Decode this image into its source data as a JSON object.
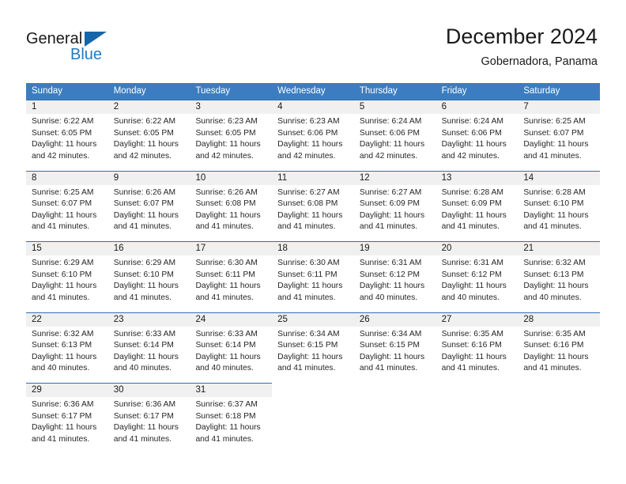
{
  "brand": {
    "name_part1": "General",
    "name_part2": "Blue"
  },
  "header": {
    "title": "December 2024",
    "subtitle": "Gobernadora, Panama"
  },
  "colors": {
    "header_blue": "#3b7dc0",
    "rule_blue": "#2f6fb5",
    "daynum_band": "#f0f0f0",
    "logo_blue": "#1f7bc4"
  },
  "weekday_headers": [
    "Sunday",
    "Monday",
    "Tuesday",
    "Wednesday",
    "Thursday",
    "Friday",
    "Saturday"
  ],
  "weeks": [
    [
      {
        "day": "1",
        "sunrise": "Sunrise: 6:22 AM",
        "sunset": "Sunset: 6:05 PM",
        "daylight1": "Daylight: 11 hours",
        "daylight2": "and 42 minutes."
      },
      {
        "day": "2",
        "sunrise": "Sunrise: 6:22 AM",
        "sunset": "Sunset: 6:05 PM",
        "daylight1": "Daylight: 11 hours",
        "daylight2": "and 42 minutes."
      },
      {
        "day": "3",
        "sunrise": "Sunrise: 6:23 AM",
        "sunset": "Sunset: 6:05 PM",
        "daylight1": "Daylight: 11 hours",
        "daylight2": "and 42 minutes."
      },
      {
        "day": "4",
        "sunrise": "Sunrise: 6:23 AM",
        "sunset": "Sunset: 6:06 PM",
        "daylight1": "Daylight: 11 hours",
        "daylight2": "and 42 minutes."
      },
      {
        "day": "5",
        "sunrise": "Sunrise: 6:24 AM",
        "sunset": "Sunset: 6:06 PM",
        "daylight1": "Daylight: 11 hours",
        "daylight2": "and 42 minutes."
      },
      {
        "day": "6",
        "sunrise": "Sunrise: 6:24 AM",
        "sunset": "Sunset: 6:06 PM",
        "daylight1": "Daylight: 11 hours",
        "daylight2": "and 42 minutes."
      },
      {
        "day": "7",
        "sunrise": "Sunrise: 6:25 AM",
        "sunset": "Sunset: 6:07 PM",
        "daylight1": "Daylight: 11 hours",
        "daylight2": "and 41 minutes."
      }
    ],
    [
      {
        "day": "8",
        "sunrise": "Sunrise: 6:25 AM",
        "sunset": "Sunset: 6:07 PM",
        "daylight1": "Daylight: 11 hours",
        "daylight2": "and 41 minutes."
      },
      {
        "day": "9",
        "sunrise": "Sunrise: 6:26 AM",
        "sunset": "Sunset: 6:07 PM",
        "daylight1": "Daylight: 11 hours",
        "daylight2": "and 41 minutes."
      },
      {
        "day": "10",
        "sunrise": "Sunrise: 6:26 AM",
        "sunset": "Sunset: 6:08 PM",
        "daylight1": "Daylight: 11 hours",
        "daylight2": "and 41 minutes."
      },
      {
        "day": "11",
        "sunrise": "Sunrise: 6:27 AM",
        "sunset": "Sunset: 6:08 PM",
        "daylight1": "Daylight: 11 hours",
        "daylight2": "and 41 minutes."
      },
      {
        "day": "12",
        "sunrise": "Sunrise: 6:27 AM",
        "sunset": "Sunset: 6:09 PM",
        "daylight1": "Daylight: 11 hours",
        "daylight2": "and 41 minutes."
      },
      {
        "day": "13",
        "sunrise": "Sunrise: 6:28 AM",
        "sunset": "Sunset: 6:09 PM",
        "daylight1": "Daylight: 11 hours",
        "daylight2": "and 41 minutes."
      },
      {
        "day": "14",
        "sunrise": "Sunrise: 6:28 AM",
        "sunset": "Sunset: 6:10 PM",
        "daylight1": "Daylight: 11 hours",
        "daylight2": "and 41 minutes."
      }
    ],
    [
      {
        "day": "15",
        "sunrise": "Sunrise: 6:29 AM",
        "sunset": "Sunset: 6:10 PM",
        "daylight1": "Daylight: 11 hours",
        "daylight2": "and 41 minutes."
      },
      {
        "day": "16",
        "sunrise": "Sunrise: 6:29 AM",
        "sunset": "Sunset: 6:10 PM",
        "daylight1": "Daylight: 11 hours",
        "daylight2": "and 41 minutes."
      },
      {
        "day": "17",
        "sunrise": "Sunrise: 6:30 AM",
        "sunset": "Sunset: 6:11 PM",
        "daylight1": "Daylight: 11 hours",
        "daylight2": "and 41 minutes."
      },
      {
        "day": "18",
        "sunrise": "Sunrise: 6:30 AM",
        "sunset": "Sunset: 6:11 PM",
        "daylight1": "Daylight: 11 hours",
        "daylight2": "and 41 minutes."
      },
      {
        "day": "19",
        "sunrise": "Sunrise: 6:31 AM",
        "sunset": "Sunset: 6:12 PM",
        "daylight1": "Daylight: 11 hours",
        "daylight2": "and 40 minutes."
      },
      {
        "day": "20",
        "sunrise": "Sunrise: 6:31 AM",
        "sunset": "Sunset: 6:12 PM",
        "daylight1": "Daylight: 11 hours",
        "daylight2": "and 40 minutes."
      },
      {
        "day": "21",
        "sunrise": "Sunrise: 6:32 AM",
        "sunset": "Sunset: 6:13 PM",
        "daylight1": "Daylight: 11 hours",
        "daylight2": "and 40 minutes."
      }
    ],
    [
      {
        "day": "22",
        "sunrise": "Sunrise: 6:32 AM",
        "sunset": "Sunset: 6:13 PM",
        "daylight1": "Daylight: 11 hours",
        "daylight2": "and 40 minutes."
      },
      {
        "day": "23",
        "sunrise": "Sunrise: 6:33 AM",
        "sunset": "Sunset: 6:14 PM",
        "daylight1": "Daylight: 11 hours",
        "daylight2": "and 40 minutes."
      },
      {
        "day": "24",
        "sunrise": "Sunrise: 6:33 AM",
        "sunset": "Sunset: 6:14 PM",
        "daylight1": "Daylight: 11 hours",
        "daylight2": "and 40 minutes."
      },
      {
        "day": "25",
        "sunrise": "Sunrise: 6:34 AM",
        "sunset": "Sunset: 6:15 PM",
        "daylight1": "Daylight: 11 hours",
        "daylight2": "and 41 minutes."
      },
      {
        "day": "26",
        "sunrise": "Sunrise: 6:34 AM",
        "sunset": "Sunset: 6:15 PM",
        "daylight1": "Daylight: 11 hours",
        "daylight2": "and 41 minutes."
      },
      {
        "day": "27",
        "sunrise": "Sunrise: 6:35 AM",
        "sunset": "Sunset: 6:16 PM",
        "daylight1": "Daylight: 11 hours",
        "daylight2": "and 41 minutes."
      },
      {
        "day": "28",
        "sunrise": "Sunrise: 6:35 AM",
        "sunset": "Sunset: 6:16 PM",
        "daylight1": "Daylight: 11 hours",
        "daylight2": "and 41 minutes."
      }
    ],
    [
      {
        "day": "29",
        "sunrise": "Sunrise: 6:36 AM",
        "sunset": "Sunset: 6:17 PM",
        "daylight1": "Daylight: 11 hours",
        "daylight2": "and 41 minutes."
      },
      {
        "day": "30",
        "sunrise": "Sunrise: 6:36 AM",
        "sunset": "Sunset: 6:17 PM",
        "daylight1": "Daylight: 11 hours",
        "daylight2": "and 41 minutes."
      },
      {
        "day": "31",
        "sunrise": "Sunrise: 6:37 AM",
        "sunset": "Sunset: 6:18 PM",
        "daylight1": "Daylight: 11 hours",
        "daylight2": "and 41 minutes."
      },
      {
        "day": "",
        "sunrise": "",
        "sunset": "",
        "daylight1": "",
        "daylight2": ""
      },
      {
        "day": "",
        "sunrise": "",
        "sunset": "",
        "daylight1": "",
        "daylight2": ""
      },
      {
        "day": "",
        "sunrise": "",
        "sunset": "",
        "daylight1": "",
        "daylight2": ""
      },
      {
        "day": "",
        "sunrise": "",
        "sunset": "",
        "daylight1": "",
        "daylight2": ""
      }
    ]
  ]
}
